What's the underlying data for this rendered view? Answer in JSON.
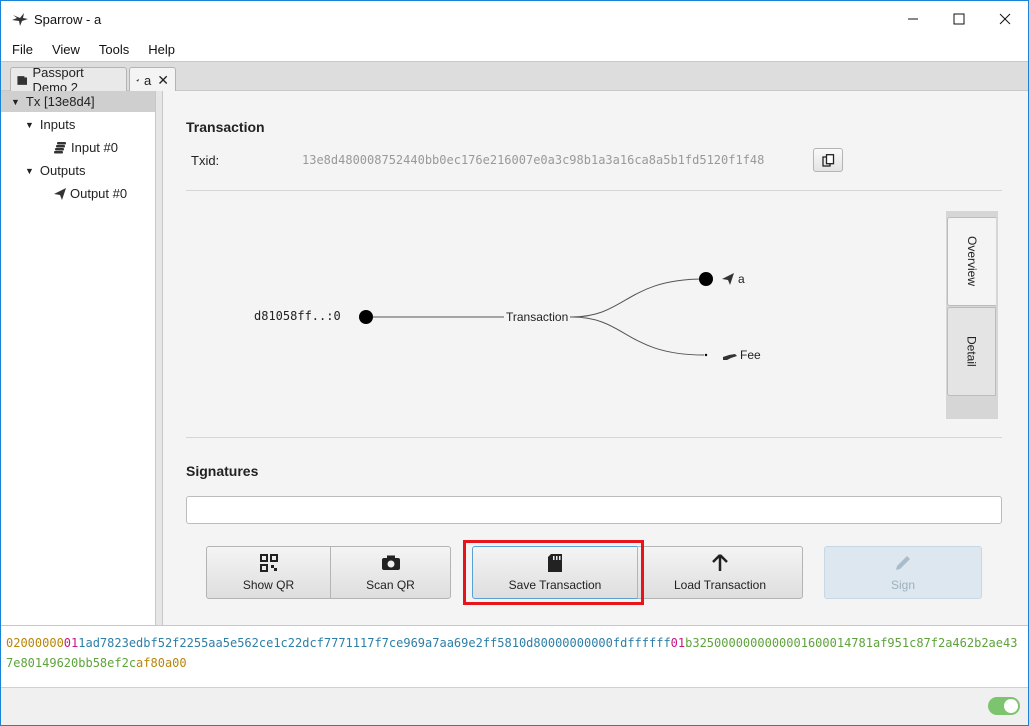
{
  "window": {
    "title": "Sparrow - a",
    "icons": {
      "app": "sparrow-bird-icon",
      "minimize": "minimize-icon",
      "maximize": "maximize-icon",
      "close": "close-icon"
    }
  },
  "menu": [
    "File",
    "View",
    "Tools",
    "Help"
  ],
  "tabs": [
    {
      "label": "Passport Demo 2",
      "icon": "wallet-icon",
      "active": false
    },
    {
      "label": "a",
      "icon": "send-icon",
      "active": true,
      "closable": true
    }
  ],
  "tree": {
    "root": "Tx [13e8d4]",
    "inputs_label": "Inputs",
    "input_item": "Input #0",
    "outputs_label": "Outputs",
    "output_item": "Output #0"
  },
  "transaction": {
    "heading": "Transaction",
    "txid_label": "Txid:",
    "txid": "13e8d480008752440bb0ec176e216007e0a3c98b1a3a16ca8a5b1fd5120f1f48",
    "copy_icon": "copy-icon"
  },
  "diagram": {
    "input": "d81058ff..:0",
    "center": "Transaction",
    "output": "a",
    "fee": "Fee"
  },
  "side_tabs": {
    "overview": "Overview",
    "detail": "Detail",
    "selected": "Overview"
  },
  "signatures": {
    "heading": "Signatures",
    "progress": 0
  },
  "buttons": {
    "show_qr": "Show QR",
    "scan_qr": "Scan QR",
    "save": "Save Transaction",
    "load": "Load Transaction",
    "sign": "Sign"
  },
  "hex": [
    {
      "text": "02000000",
      "color": "#b8860b"
    },
    {
      "text": "01",
      "color": "#c71585"
    },
    {
      "text": "1ad7823edbf52f2255aa5e562ce1c22dcf7771117f7ce969a7aa69e2ff5810d80000000000fdffffff",
      "color": "#2d7fa8"
    },
    {
      "text": "01",
      "color": "#c71585"
    },
    {
      "text": "b3250000000000001600014781af951c87f2a462b2ae437e80149620bb58ef2c",
      "color": "#5ea33c"
    },
    {
      "text": "af80a00",
      "color": "#b8860b"
    }
  ],
  "status": {
    "toggle_on": true
  }
}
